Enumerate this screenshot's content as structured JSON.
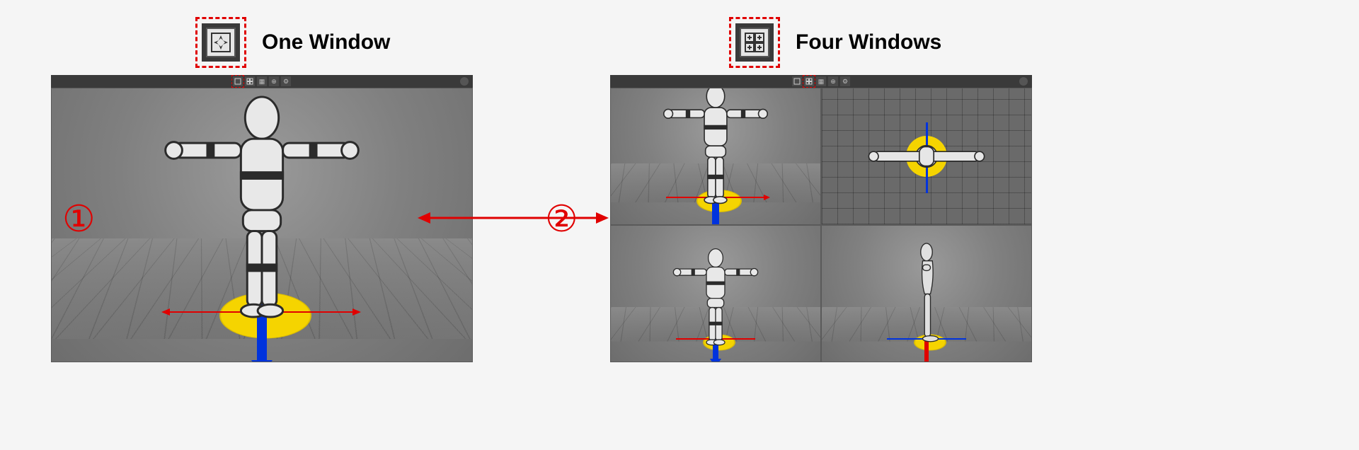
{
  "left": {
    "label": "One Window",
    "marker": "①",
    "layout_icon": "one-window-icon"
  },
  "right": {
    "label": "Four Windows",
    "marker": "②",
    "layout_icon": "four-windows-icon"
  },
  "toolbar_icons": [
    "layout-one-window",
    "layout-four-windows",
    "toggle-grid",
    "zoom-extents",
    "settings"
  ],
  "views": {
    "perspective": "Perspective",
    "top": "Top",
    "front": "Front",
    "side": "Side"
  },
  "colors": {
    "accent_red": "#e00000",
    "axis_blue": "#0033dd",
    "disc_yellow": "#f5d400"
  }
}
